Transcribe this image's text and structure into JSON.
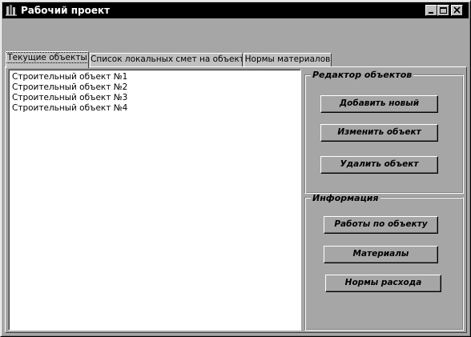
{
  "window": {
    "title": "Рабочий проект",
    "controls": {
      "minimize": "minimize",
      "maximize": "maximize",
      "close": "close"
    }
  },
  "tabs": [
    {
      "label": "Текущие объекты",
      "active": true
    },
    {
      "label": "Список локальных смет на объект",
      "active": false
    },
    {
      "label": "Нормы материалов",
      "active": false
    }
  ],
  "objects_list": {
    "items": [
      "Строительный объект №1",
      "Строительный объект №2",
      "Строительный объект №3",
      "Строительный объект №4"
    ]
  },
  "editor_group": {
    "title": "Редактор объектов",
    "add_label": "Добавить новый",
    "edit_label": "Изменить объект",
    "delete_label": "Удалить объект"
  },
  "info_group": {
    "title": "Информация",
    "works_label": "Работы по объекту",
    "materials_label": "Материалы",
    "norms_label": "Нормы расхода"
  },
  "colors": {
    "titlebar": "#000000",
    "face": "#a6a6a6",
    "list_background": "#ffffff"
  }
}
